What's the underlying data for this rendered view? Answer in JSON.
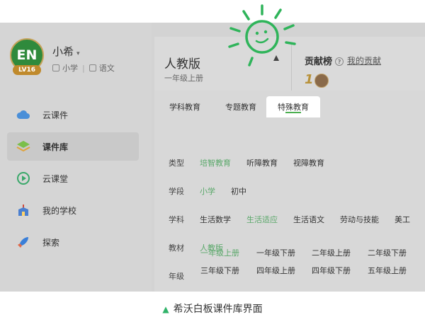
{
  "user": {
    "avatar_text": "EN",
    "level": "LV16",
    "name": "小希",
    "caret": "▾",
    "grade": "小学",
    "subject": "语文"
  },
  "sidebar": {
    "items": [
      {
        "label": "云课件",
        "icon": "cloud-icon"
      },
      {
        "label": "课件库",
        "icon": "layers-icon",
        "active": true
      },
      {
        "label": "云课堂",
        "icon": "play-circle-icon"
      },
      {
        "label": "我的学校",
        "icon": "school-icon"
      },
      {
        "label": "探索",
        "icon": "rocket-icon"
      }
    ]
  },
  "header": {
    "title": "人教版",
    "subtitle": "一年级上册",
    "rank_title": "贡献榜",
    "help_glyph": "?",
    "my_contribution": "我的贡献",
    "rank_number": "1"
  },
  "tabs": [
    {
      "label": "学科教育"
    },
    {
      "label": "专题教育"
    },
    {
      "label": "特殊教育",
      "active": true
    }
  ],
  "filters": {
    "type": {
      "label": "类型",
      "options": [
        "培智教育",
        "听障教育",
        "视障教育"
      ],
      "selected": "培智教育"
    },
    "stage": {
      "label": "学段",
      "options": [
        "小学",
        "初中"
      ],
      "selected": "小学"
    },
    "subject": {
      "label": "学科",
      "options": [
        "生活数学",
        "生活适应",
        "生活语文",
        "劳动与技能",
        "美工"
      ],
      "selected": "生活适应"
    },
    "textbook": {
      "label": "教材",
      "options": [
        "人教版"
      ],
      "selected": "人教版"
    },
    "grade": {
      "label": "年级",
      "options": [
        "一年级上册",
        "一年级下册",
        "二年级上册",
        "二年级下册",
        "三年级下册",
        "四年级上册",
        "四年级下册",
        "五年级上册"
      ],
      "selected": "一年级上册"
    }
  },
  "caption": {
    "marker": "▲",
    "text": "希沃白板课件库界面"
  },
  "colors": {
    "accent": "#4caf50",
    "sun": "#2fb45a"
  }
}
